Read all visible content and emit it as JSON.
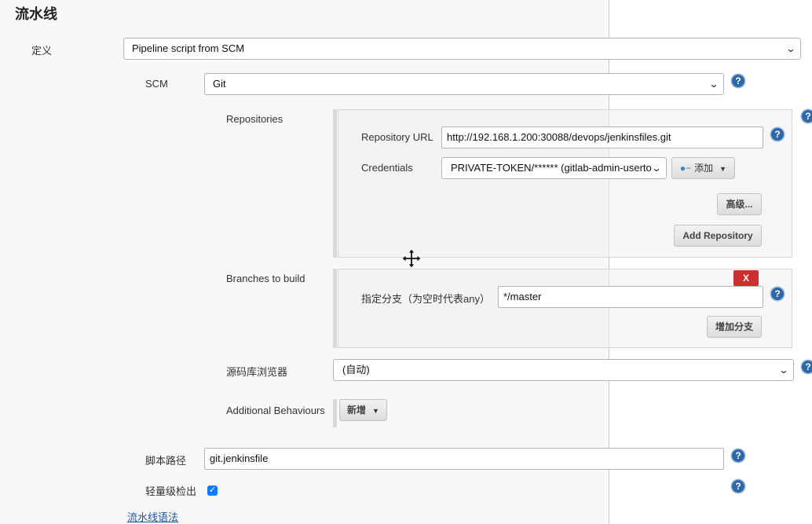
{
  "section": {
    "title": "流水线"
  },
  "definition": {
    "label": "定义",
    "selected": "Pipeline script from SCM"
  },
  "scm": {
    "label": "SCM",
    "selected": "Git"
  },
  "repositories": {
    "label": "Repositories",
    "url_label": "Repository URL",
    "url_value": "http://192.168.1.200:30088/devops/jenkinsfiles.git",
    "credentials_label": "Credentials",
    "credentials_selected": "PRIVATE-TOKEN/****** (gitlab-admin-userto",
    "add_label": "添加",
    "advanced_label": "高级...",
    "add_repository_label": "Add Repository"
  },
  "branches": {
    "label": "Branches to build",
    "delete_label": "X",
    "branch_label": "指定分支（为空时代表any）",
    "branch_value": "*/master",
    "add_branch_label": "增加分支"
  },
  "browser": {
    "label": "源码库浏览器",
    "selected": "(自动)"
  },
  "behaviours": {
    "label": "Additional Behaviours",
    "add_label": "新增"
  },
  "script_path": {
    "label": "脚本路径",
    "value": "git.jenkinsfile"
  },
  "lightweight": {
    "label": "轻量级检出",
    "checked": true
  },
  "syntax_link": {
    "label": "流水线语法"
  },
  "icons": {
    "help": "help-icon",
    "dropdown": "chevron-down-icon",
    "key": "key-icon",
    "cursor": "move-cursor-icon"
  },
  "colors": {
    "help": "#2f68a9",
    "delete": "#cc2f2f",
    "checkbox": "#0a7aff",
    "link": "#1c54a8"
  }
}
